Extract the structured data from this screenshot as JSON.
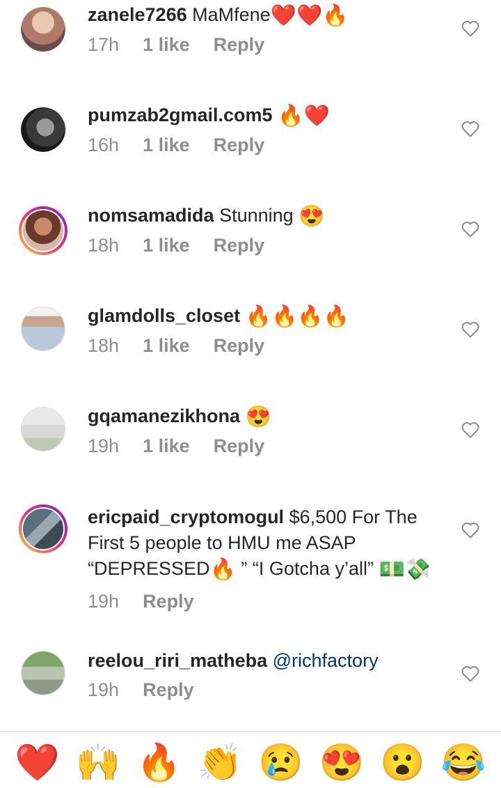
{
  "comments": [
    {
      "user": "zanele7266",
      "text": "MaMfene",
      "emoji": "❤️❤️🔥",
      "time": "17h",
      "likes": "1 like",
      "reply": "Reply"
    },
    {
      "user": "pumzab2gmail.com5",
      "text": "",
      "emoji": "🔥❤️",
      "time": "16h",
      "likes": "1 like",
      "reply": "Reply"
    },
    {
      "user": "nomsamadida",
      "text": "Stunning",
      "emoji": "😍",
      "time": "18h",
      "likes": "1 like",
      "reply": "Reply"
    },
    {
      "user": "glamdolls_closet",
      "text": "",
      "emoji": "🔥🔥🔥🔥",
      "time": "18h",
      "likes": "1 like",
      "reply": "Reply"
    },
    {
      "user": "gqamanezikhona",
      "text": "",
      "emoji": "😍",
      "time": "19h",
      "likes": "1 like",
      "reply": "Reply"
    },
    {
      "user": "ericpaid_cryptomogul",
      "text_a": "$6,500 For The First 5 people to HMU me ASAP “DEPRESSED",
      "emoji_a": "🔥",
      "text_b": "” “I Gotcha y’all”",
      "emoji_b": "💵💸",
      "time": "19h",
      "reply": "Reply"
    },
    {
      "user": "reelou_riri_matheba",
      "mention": "@richfactory",
      "time": "19h",
      "reply": "Reply"
    }
  ],
  "reactions": [
    "❤️",
    "🙌",
    "🔥",
    "👏",
    "😢",
    "😍",
    "😮",
    "😂"
  ]
}
